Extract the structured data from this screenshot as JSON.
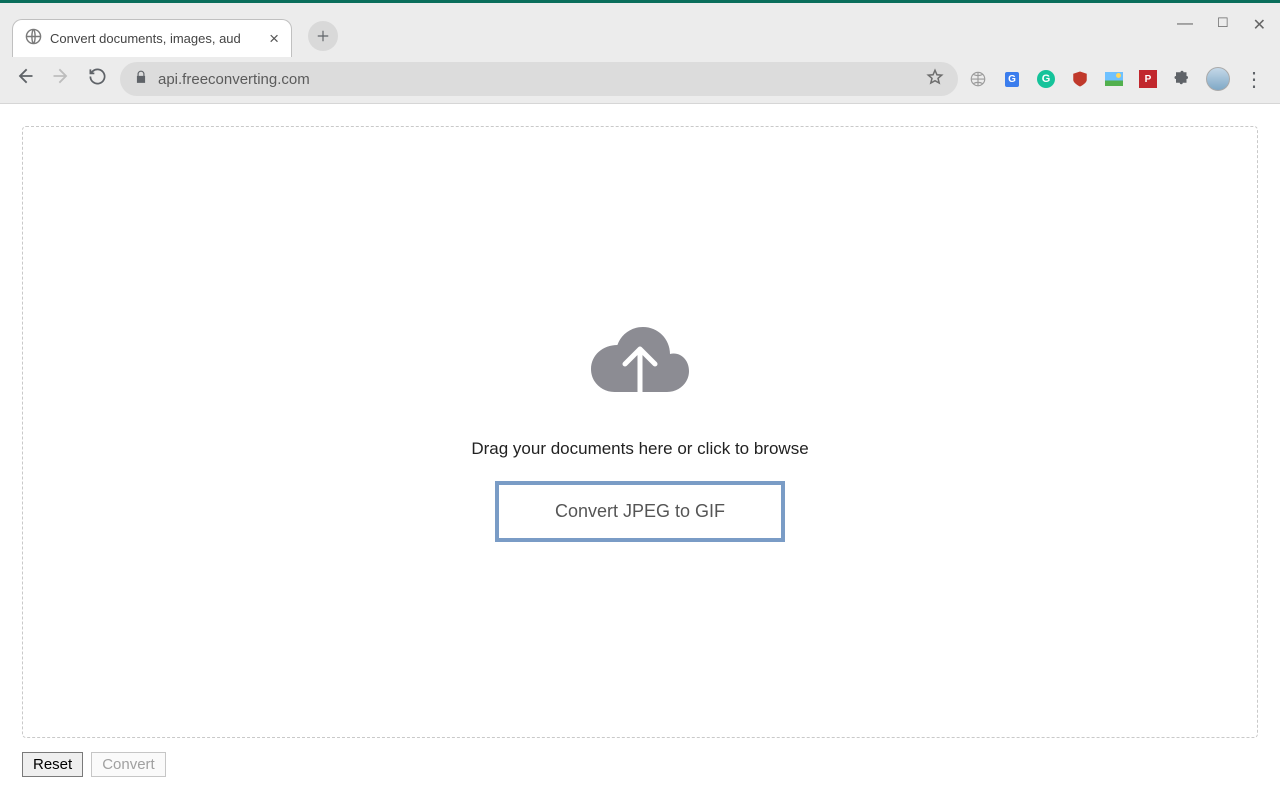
{
  "browser": {
    "tab_title": "Convert documents, images, aud",
    "url": "api.freeconverting.com",
    "new_tab_tooltip": "New Tab"
  },
  "page": {
    "drop_text": "Drag your documents here or click to browse",
    "convert_label": "Convert JPEG to GIF",
    "reset_label": "Reset",
    "submit_label": "Convert"
  }
}
